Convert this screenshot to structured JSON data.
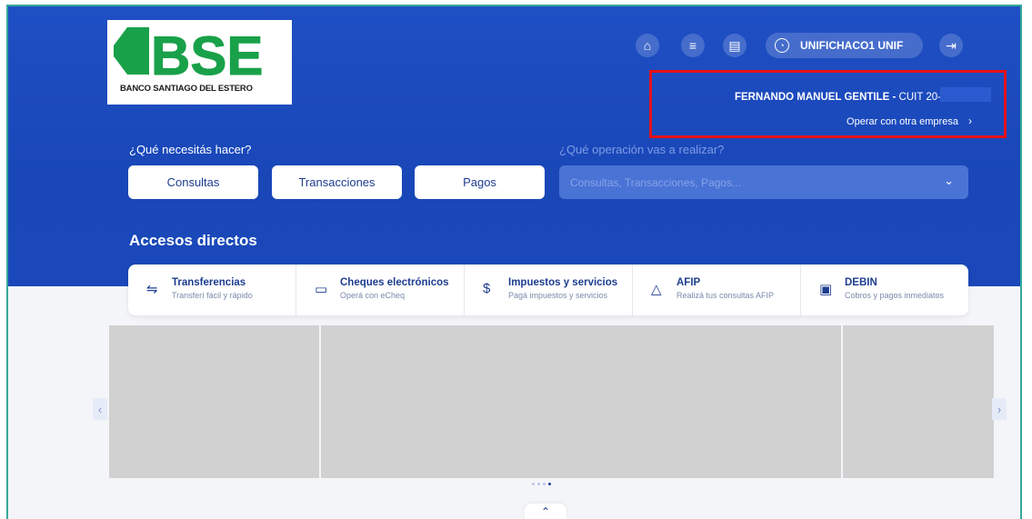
{
  "header": {
    "logo": {
      "brand": "BSE",
      "tagline": "BANCO SANTIAGO DEL ESTERO"
    },
    "icons": [
      "home-icon",
      "menu-icon",
      "print-icon",
      "user-icon",
      "logout-icon"
    ],
    "user": {
      "name": "UNIFICHACO1 UNIF"
    }
  },
  "company": {
    "name": "FERNANDO MANUEL GENTILE -",
    "cuit_label": "CUIT 20-",
    "switch_label": "Operar con otra empresa",
    "switch_chevron": "›"
  },
  "actions": {
    "question": "¿Qué necesitás hacer?",
    "buttons": [
      "Consultas",
      "Transacciones",
      "Pagos"
    ],
    "operation_question": "¿Qué operación vas a realizar?",
    "operation_placeholder": "Consultas, Transacciones, Pagos...",
    "dropdown_chevron": "⌄"
  },
  "shortcuts": {
    "title": "Accesos directos",
    "items": [
      {
        "icon": "transfer-icon",
        "title": "Transferencias",
        "subtitle": "Transferí fácil y rápido"
      },
      {
        "icon": "check-icon",
        "title": "Cheques electrónicos",
        "subtitle": "Operá con eCheq"
      },
      {
        "icon": "tax-icon",
        "title": "Impuestos y servicios",
        "subtitle": "Pagá impuestos y servicios"
      },
      {
        "icon": "afip-icon",
        "title": "AFIP",
        "subtitle": "Realizá tus consultas AFIP"
      },
      {
        "icon": "debin-icon",
        "title": "DEBIN",
        "subtitle": "Cobros y pagos inmediatos"
      }
    ]
  },
  "carousel": {
    "prev": "‹",
    "next": "›",
    "slides": 4,
    "active_slide": 4
  },
  "footer": {
    "collapse_icon": "⌃"
  },
  "colors": {
    "primary": "#1f4fc4",
    "accent_text": "#1e3d8f",
    "highlight": "#e4111a"
  }
}
